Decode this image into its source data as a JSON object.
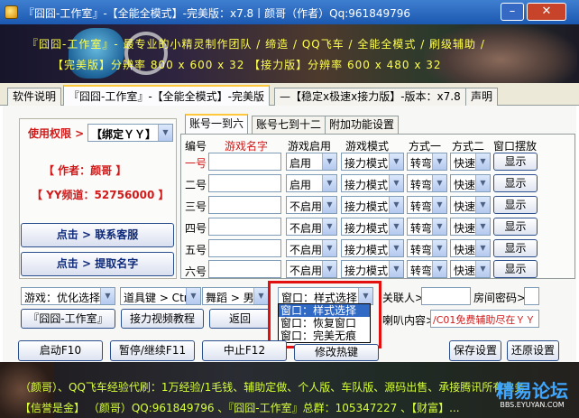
{
  "window": {
    "title": "『囧囧-工作室』-【全能全模式】-完美版：x7.8丨颜哥（作者）Qq:961849796",
    "min_label": "–",
    "close_label": "✕"
  },
  "banner": {
    "line1": "『囧囧-工作室』- 最专业的小精灵制作团队 / 缔造 / QQ飞车 / 全能全模式 / 刷级辅助 /",
    "line2": "【完美版】分辨率 800 x 600 x 32     【接力版】分辨率 600 x 480 x 32"
  },
  "tabs": [
    {
      "label": "软件说明"
    },
    {
      "label": "『囧囧-工作室』-【全能全模式】-完美版"
    },
    {
      "label": "—【稳定x极速x接力版】-版本：x7.8"
    },
    {
      "label": "声明"
    }
  ],
  "left": {
    "perm_label": "使用权限 >",
    "perm_value": "【绑定ＹＹ】",
    "author": "【 作者：颜哥 】",
    "yy": "【 YY频道：52756000 】",
    "contact_btn": "点击 > 联系客服",
    "fetch_btn": "点击 > 提取名字"
  },
  "subtabs": [
    {
      "label": "账号一到六"
    },
    {
      "label": "账号七到十二"
    },
    {
      "label": "附加功能设置"
    }
  ],
  "grid": {
    "headers": [
      "编号",
      "游戏名字",
      "游戏启用",
      "游戏模式",
      "方式一",
      "方式二",
      "窗口摆放"
    ],
    "rows": [
      {
        "label": "一号",
        "enabled": "启用",
        "mode": "接力模式",
        "way1": "转弯",
        "way2": "快速",
        "show": "显示"
      },
      {
        "label": "二号",
        "enabled": "启用",
        "mode": "接力模式",
        "way1": "转弯",
        "way2": "快速",
        "show": "显示"
      },
      {
        "label": "三号",
        "enabled": "不启用",
        "mode": "接力模式",
        "way1": "转弯",
        "way2": "快速",
        "show": "显示"
      },
      {
        "label": "四号",
        "enabled": "不启用",
        "mode": "接力模式",
        "way1": "转弯",
        "way2": "快速",
        "show": "显示"
      },
      {
        "label": "五号",
        "enabled": "不启用",
        "mode": "接力模式",
        "way1": "转弯",
        "way2": "快速",
        "show": "显示"
      },
      {
        "label": "六号",
        "enabled": "不启用",
        "mode": "接力模式",
        "way1": "转弯",
        "way2": "快速",
        "show": "显示"
      }
    ]
  },
  "controls": {
    "game_select": "游戏：优化选择",
    "prop_select": "道具键 > Ctrl",
    "dance_select": "舞蹈 > 男号",
    "window_select": "窗口：样式选择",
    "contact_label": "关联人>",
    "room_pwd_label": "房间密码>",
    "studio_btn": "『囧囧-工作室』",
    "video_btn": "接力视频教程",
    "back_btn": "返回",
    "horn_label": "喇叭内容>",
    "horn_value": "/C01免费辅助尽在ＹＹ"
  },
  "window_dropdown": {
    "options": [
      "窗口：样式选择",
      "窗口：恢复窗口",
      "窗口：完美无痕"
    ],
    "selected_index": 0
  },
  "actions": {
    "start": "启动F10",
    "pause": "暂停/继续F11",
    "stop": "中止F12",
    "hotkey": "修改热键",
    "save": "保存设置",
    "restore": "还原设置"
  },
  "footer": {
    "line1": "（颜哥）、QQ飞车经验代刷：1万经验/1毛钱、辅助定做、个人版、车队版、源码出售、承接腾讯所有业务",
    "line2": "【信誉是金】 （颜哥）QQ:961849796 、『囧囧-工作室』总群：105347227 、【财富】..."
  },
  "watermark": {
    "main": "精易论坛",
    "sub": "BBS.EYUYAN.COM"
  }
}
